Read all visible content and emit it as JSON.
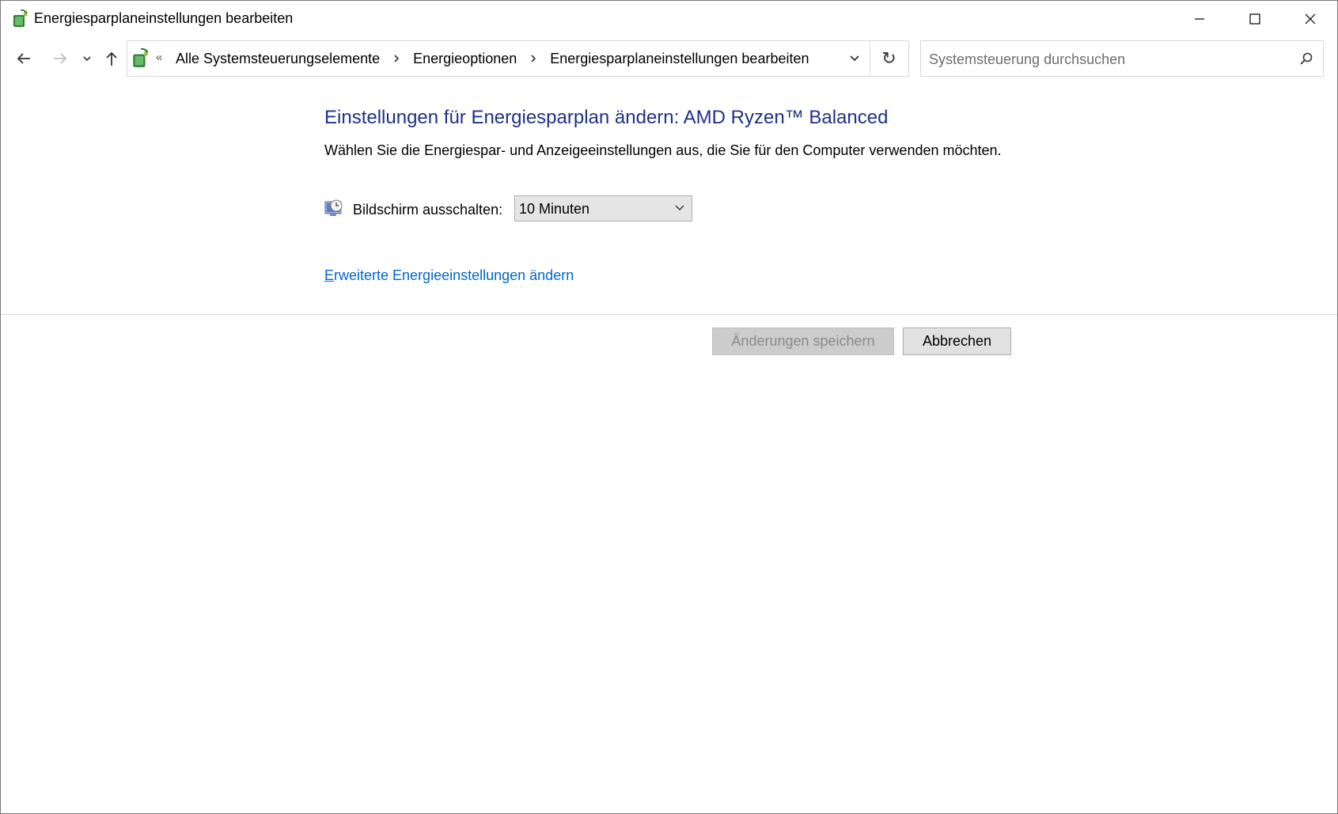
{
  "window": {
    "title": "Energiesparplaneinstellungen bearbeiten"
  },
  "address_bar": {
    "overflow": "«",
    "breadcrumbs": [
      "Alle Systemsteuerungselemente",
      "Energieoptionen",
      "Energiesparplaneinstellungen bearbeiten"
    ],
    "refresh_glyph": "↻"
  },
  "search": {
    "placeholder": "Systemsteuerung durchsuchen"
  },
  "main": {
    "title": "Einstellungen für Energiesparplan ändern: AMD Ryzen™ Balanced",
    "subtitle": "Wählen Sie die Energiespar- und Anzeigeeinstellungen aus, die Sie für den Computer verwenden möchten.",
    "display_off_label": "Bildschirm ausschalten:",
    "display_off_value": "10 Minuten",
    "advanced_link_accel": "E",
    "advanced_link_rest": "rweiterte Energieeinstellungen ändern"
  },
  "buttons": {
    "save": "Änderungen speichern",
    "cancel": "Abbrechen"
  },
  "icons": {
    "app": "power-options-icon",
    "monitor": "monitor-clock-icon",
    "search": "search-icon"
  },
  "colors": {
    "title_blue": "#1e3287",
    "link_blue": "#0066cc"
  }
}
